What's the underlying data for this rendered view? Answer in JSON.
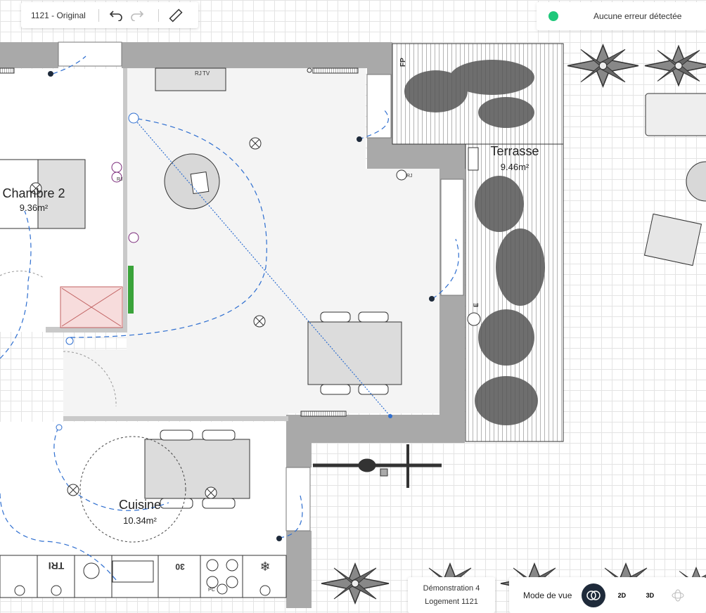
{
  "toolbar": {
    "title": "1121 - Original",
    "undo_icon": "undo-icon",
    "redo_icon": "redo-icon",
    "measure_icon": "ruler-icon"
  },
  "status": {
    "text": "Aucune erreur détectée",
    "color": "#1ec87a"
  },
  "rooms": {
    "chambre": {
      "name": "Chambre 2",
      "area": "9.36m²"
    },
    "terrasse": {
      "name": "Terrasse",
      "area": "9.46m²"
    },
    "cuisine": {
      "name": "Cuisine",
      "area": "10.34m²"
    }
  },
  "labels": {
    "fp": "FP",
    "rj_a": "RJ",
    "tv": "TV",
    "rj_b": "RJ",
    "rj_c": "RJ",
    "e": "E",
    "tri": "TRI",
    "temp": "30",
    "pc": "PC"
  },
  "project": {
    "name": "Démonstration 4",
    "unit": "Logement 1121"
  },
  "viewmode": {
    "label": "Mode de vue",
    "btn_2d": "2D",
    "btn_3d": "3D"
  },
  "colors": {
    "wall": "#a9a9a9",
    "floor": "#f4f4f4",
    "furniture": "#dcdcdc",
    "circuit": "#2f6fd0",
    "socket_special": "#7a2a7a",
    "radiator_green": "#3aa33a",
    "panel_red": "#d88a8a"
  }
}
